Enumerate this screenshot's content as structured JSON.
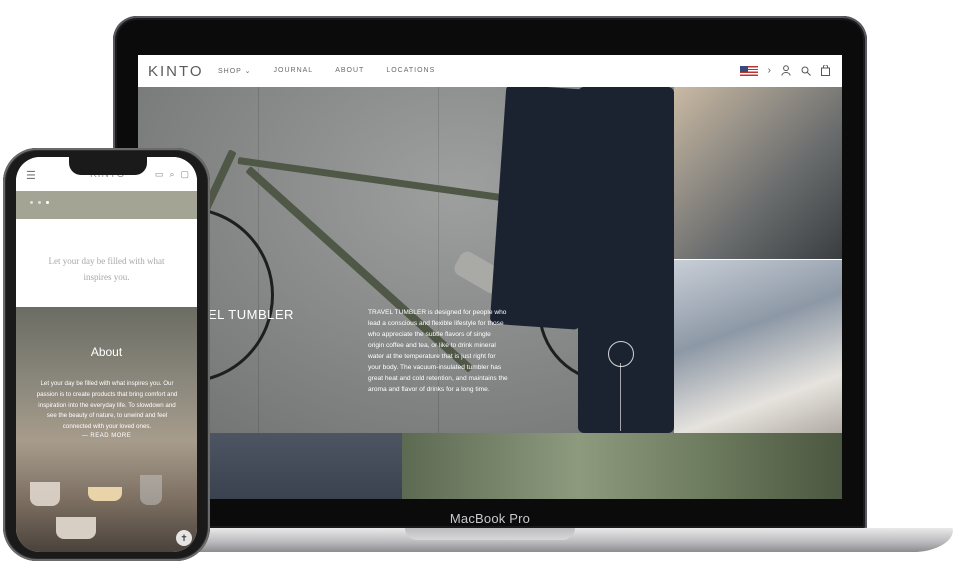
{
  "laptop": {
    "model_label": "MacBook Pro",
    "site": {
      "logo": "KINTO",
      "nav": [
        "SHOP ⌄",
        "JOURNAL",
        "ABOUT",
        "LOCATIONS"
      ],
      "header_icons": [
        "flag-us-icon",
        "chevron-right-icon",
        "user-icon",
        "search-icon",
        "bag-icon"
      ],
      "hero": {
        "title": "EL TUMBLER",
        "body": "TRAVEL TUMBLER is designed for people who lead a conscious and flexible lifestyle for those who appreciate the subtle flavors of single origin coffee and tea, or like to drink mineral water at the temperature that is just right for your body. The vacuum-insulated tumbler has great heat and cold retention, and maintains the aroma and flavor of drinks for a long time."
      }
    }
  },
  "phone": {
    "header": {
      "menu_icon": "hamburger-icon",
      "logo": "KINTO",
      "icons": [
        "flag-icon",
        "search-icon",
        "bag-icon"
      ]
    },
    "slider_dots": 3,
    "tagline": "Let your day be filled with what inspires you.",
    "about": {
      "title": "About",
      "text": "Let your day be filled with what inspires you. Our passion is to create products that bring comfort and inspiration into the everyday life. To slowdown and see the beauty of nature, to unwind and feel connected with your loved ones.",
      "read_more": "— READ MORE"
    }
  },
  "colors": {
    "laptop_bezel": "#0b0b0c",
    "phone_band": "#a3a494",
    "hero_bg": "#8b8d8d"
  }
}
